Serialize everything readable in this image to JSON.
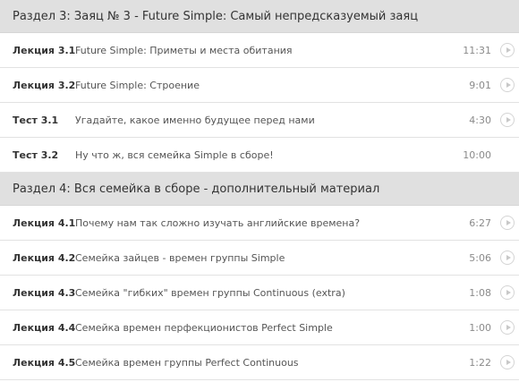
{
  "sections": [
    {
      "title": "Раздел 3: Заяц № 3 - Future Simple: Самый непредсказуемый заяц",
      "items": [
        {
          "kind": "Лекция 3.1",
          "title": "Future Simple: Приметы и места обитания",
          "duration": "11:31",
          "playable": true
        },
        {
          "kind": "Лекция 3.2",
          "title": "Future Simple: Строение",
          "duration": "9:01",
          "playable": true
        },
        {
          "kind": "Тест 3.1",
          "title": "Угадайте, какое именно будущее перед нами",
          "duration": "4:30",
          "playable": true
        },
        {
          "kind": "Тест 3.2",
          "title": "Ну что ж, вся семейка Simple в сборе!",
          "duration": "10:00",
          "playable": false
        }
      ]
    },
    {
      "title": "Раздел 4: Вся семейка в сборе - дополнительный материал",
      "items": [
        {
          "kind": "Лекция 4.1",
          "title": "Почему нам так сложно изучать английские времена?",
          "duration": "6:27",
          "playable": true
        },
        {
          "kind": "Лекция 4.2",
          "title": "Семейка зайцев - времен группы Simple",
          "duration": "5:06",
          "playable": true
        },
        {
          "kind": "Лекция 4.3",
          "title": "Семейка \"гибких\" времен группы Continuous (extra)",
          "duration": "1:08",
          "playable": true
        },
        {
          "kind": "Лекция 4.4",
          "title": "Семейка времен перфекционистов Perfect Simple",
          "duration": "1:00",
          "playable": true
        },
        {
          "kind": "Лекция 4.5",
          "title": "Семейка времен группы Perfect Continuous",
          "duration": "1:22",
          "playable": true
        }
      ]
    }
  ]
}
